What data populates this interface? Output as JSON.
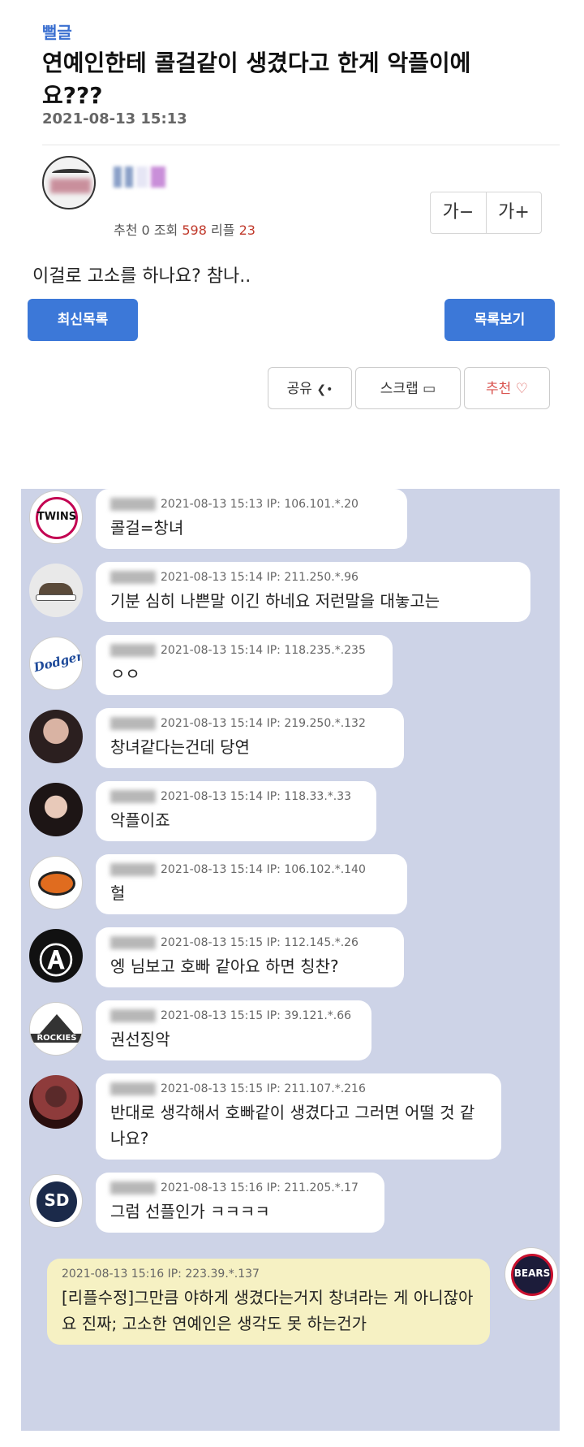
{
  "post": {
    "category": "뻘글",
    "title": "연예인한테 콜걸같이 생겼다고 한게 악플이에요???",
    "date": "2021-08-13 15:13",
    "stats": {
      "rec_label": "추천",
      "rec": "0",
      "view_label": "조회",
      "views": "598",
      "reply_label": "리플",
      "replies": "23"
    },
    "font_minus": "가−",
    "font_plus": "가+",
    "body": "이걸로 고소를 하나요? 참나..",
    "buttons": {
      "latest": "최신목록",
      "list": "목록보기",
      "share": "공유",
      "scrap": "스크랩",
      "recommend": "추천"
    }
  },
  "comments": [
    {
      "avatar": "twins",
      "avatar_text": "TWINS",
      "meta": "2021-08-13 15:13  IP: 106.101.*.20",
      "message": "콜걸=창녀"
    },
    {
      "avatar": "shoe",
      "meta": "2021-08-13 15:14  IP: 211.250.*.96",
      "message": "기분 심히 나쁜말 이긴 하네요 저런말을 대놓고는"
    },
    {
      "avatar": "dodgers",
      "avatar_text": "Dodgers",
      "meta": "2021-08-13 15:14  IP: 118.235.*.235",
      "message": "ㅇㅇ"
    },
    {
      "avatar": "photo1",
      "meta": "2021-08-13 15:14  IP: 219.250.*.132",
      "message": "창녀같다는건데 당연"
    },
    {
      "avatar": "photo2",
      "meta": "2021-08-13 15:14  IP: 118.33.*.33",
      "message": "악플이죠"
    },
    {
      "avatar": "giants",
      "meta": "2021-08-13 15:14  IP: 106.102.*.140",
      "message": "헐"
    },
    {
      "avatar": "anarchy",
      "avatar_text": "Ⓐ",
      "meta": "2021-08-13 15:15  IP: 112.145.*.26",
      "message": "엥 님보고 호빠 같아요 하면 칭찬?"
    },
    {
      "avatar": "rockies",
      "avatar_text": "ROCKIES",
      "meta": "2021-08-13 15:15  IP: 39.121.*.66",
      "message": "권선징악"
    },
    {
      "avatar": "photo3",
      "meta": "2021-08-13 15:15  IP: 211.107.*.216",
      "message": "반대로 생각해서 호빠같이 생겼다고 그러면 어떨 것 같나요?"
    },
    {
      "avatar": "padres",
      "avatar_text": "SD",
      "meta": "2021-08-13 15:16  IP: 211.205.*.17",
      "message": "그럼 선플인가 ㅋㅋㅋㅋ"
    }
  ],
  "my_comment": {
    "avatar": "bears",
    "avatar_text": "BEARS",
    "meta": "2021-08-13 15:16  IP: 223.39.*.137",
    "message": "[리플수정]그만큼 야하게 생겼다는거지 창녀라는 게 아니잖아요 진짜; 고소한 연예인은 생각도 못 하는건가"
  },
  "colors": {
    "accent_blue": "#3c78d8",
    "chat_bg": "#cdd3e7",
    "my_bubble": "#f6f1c3",
    "red": "#c0392b"
  }
}
